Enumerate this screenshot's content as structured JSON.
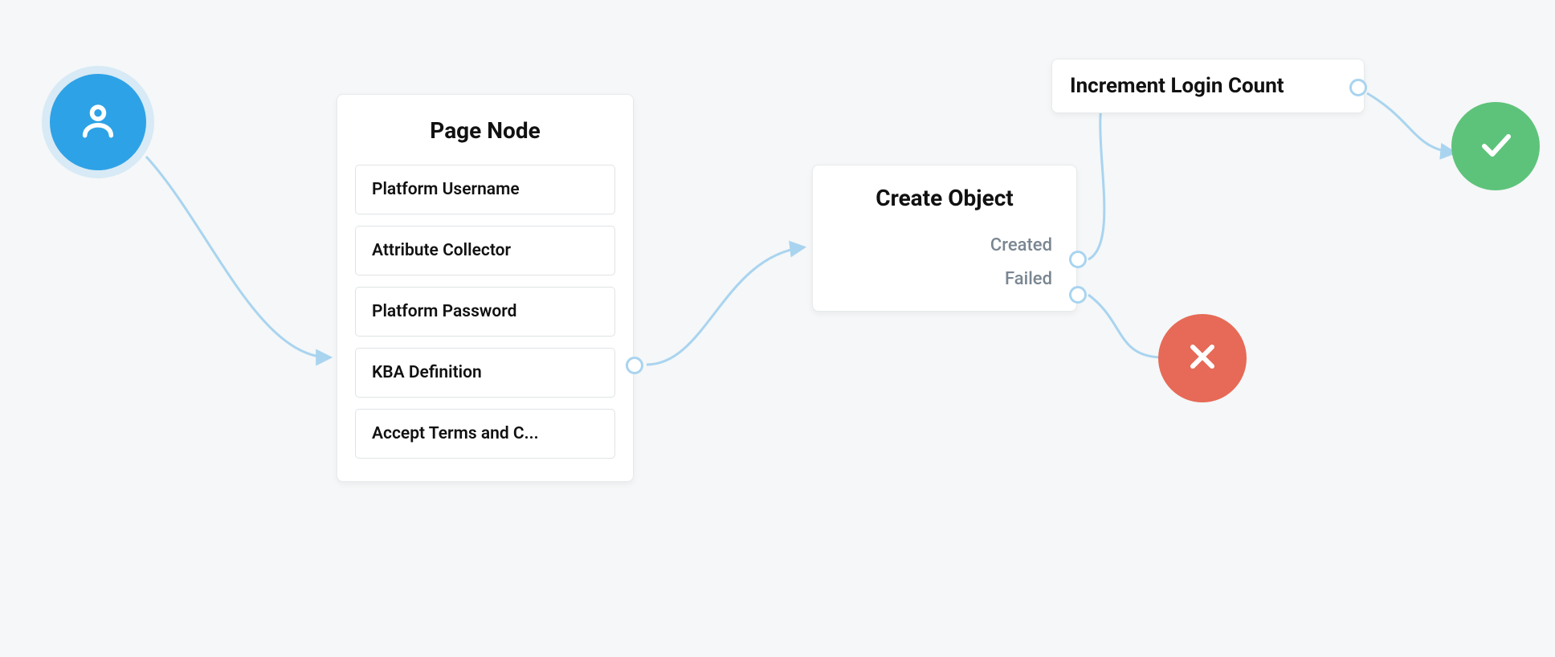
{
  "nodes": {
    "start": {
      "icon": "user-icon"
    },
    "page_node": {
      "title": "Page Node",
      "items": [
        "Platform Username",
        "Attribute Collector",
        "Platform Password",
        "KBA Definition",
        "Accept Terms and C..."
      ]
    },
    "create_object": {
      "title": "Create Object",
      "outcomes": [
        "Created",
        "Failed"
      ]
    },
    "increment": {
      "title": "Increment Login Count"
    },
    "success": {
      "icon": "check-icon"
    },
    "failure": {
      "icon": "close-icon"
    }
  },
  "colors": {
    "connector": "#a9d4ef",
    "start": "#2ea2e6",
    "success": "#5ec37a",
    "failure": "#e66a57"
  }
}
